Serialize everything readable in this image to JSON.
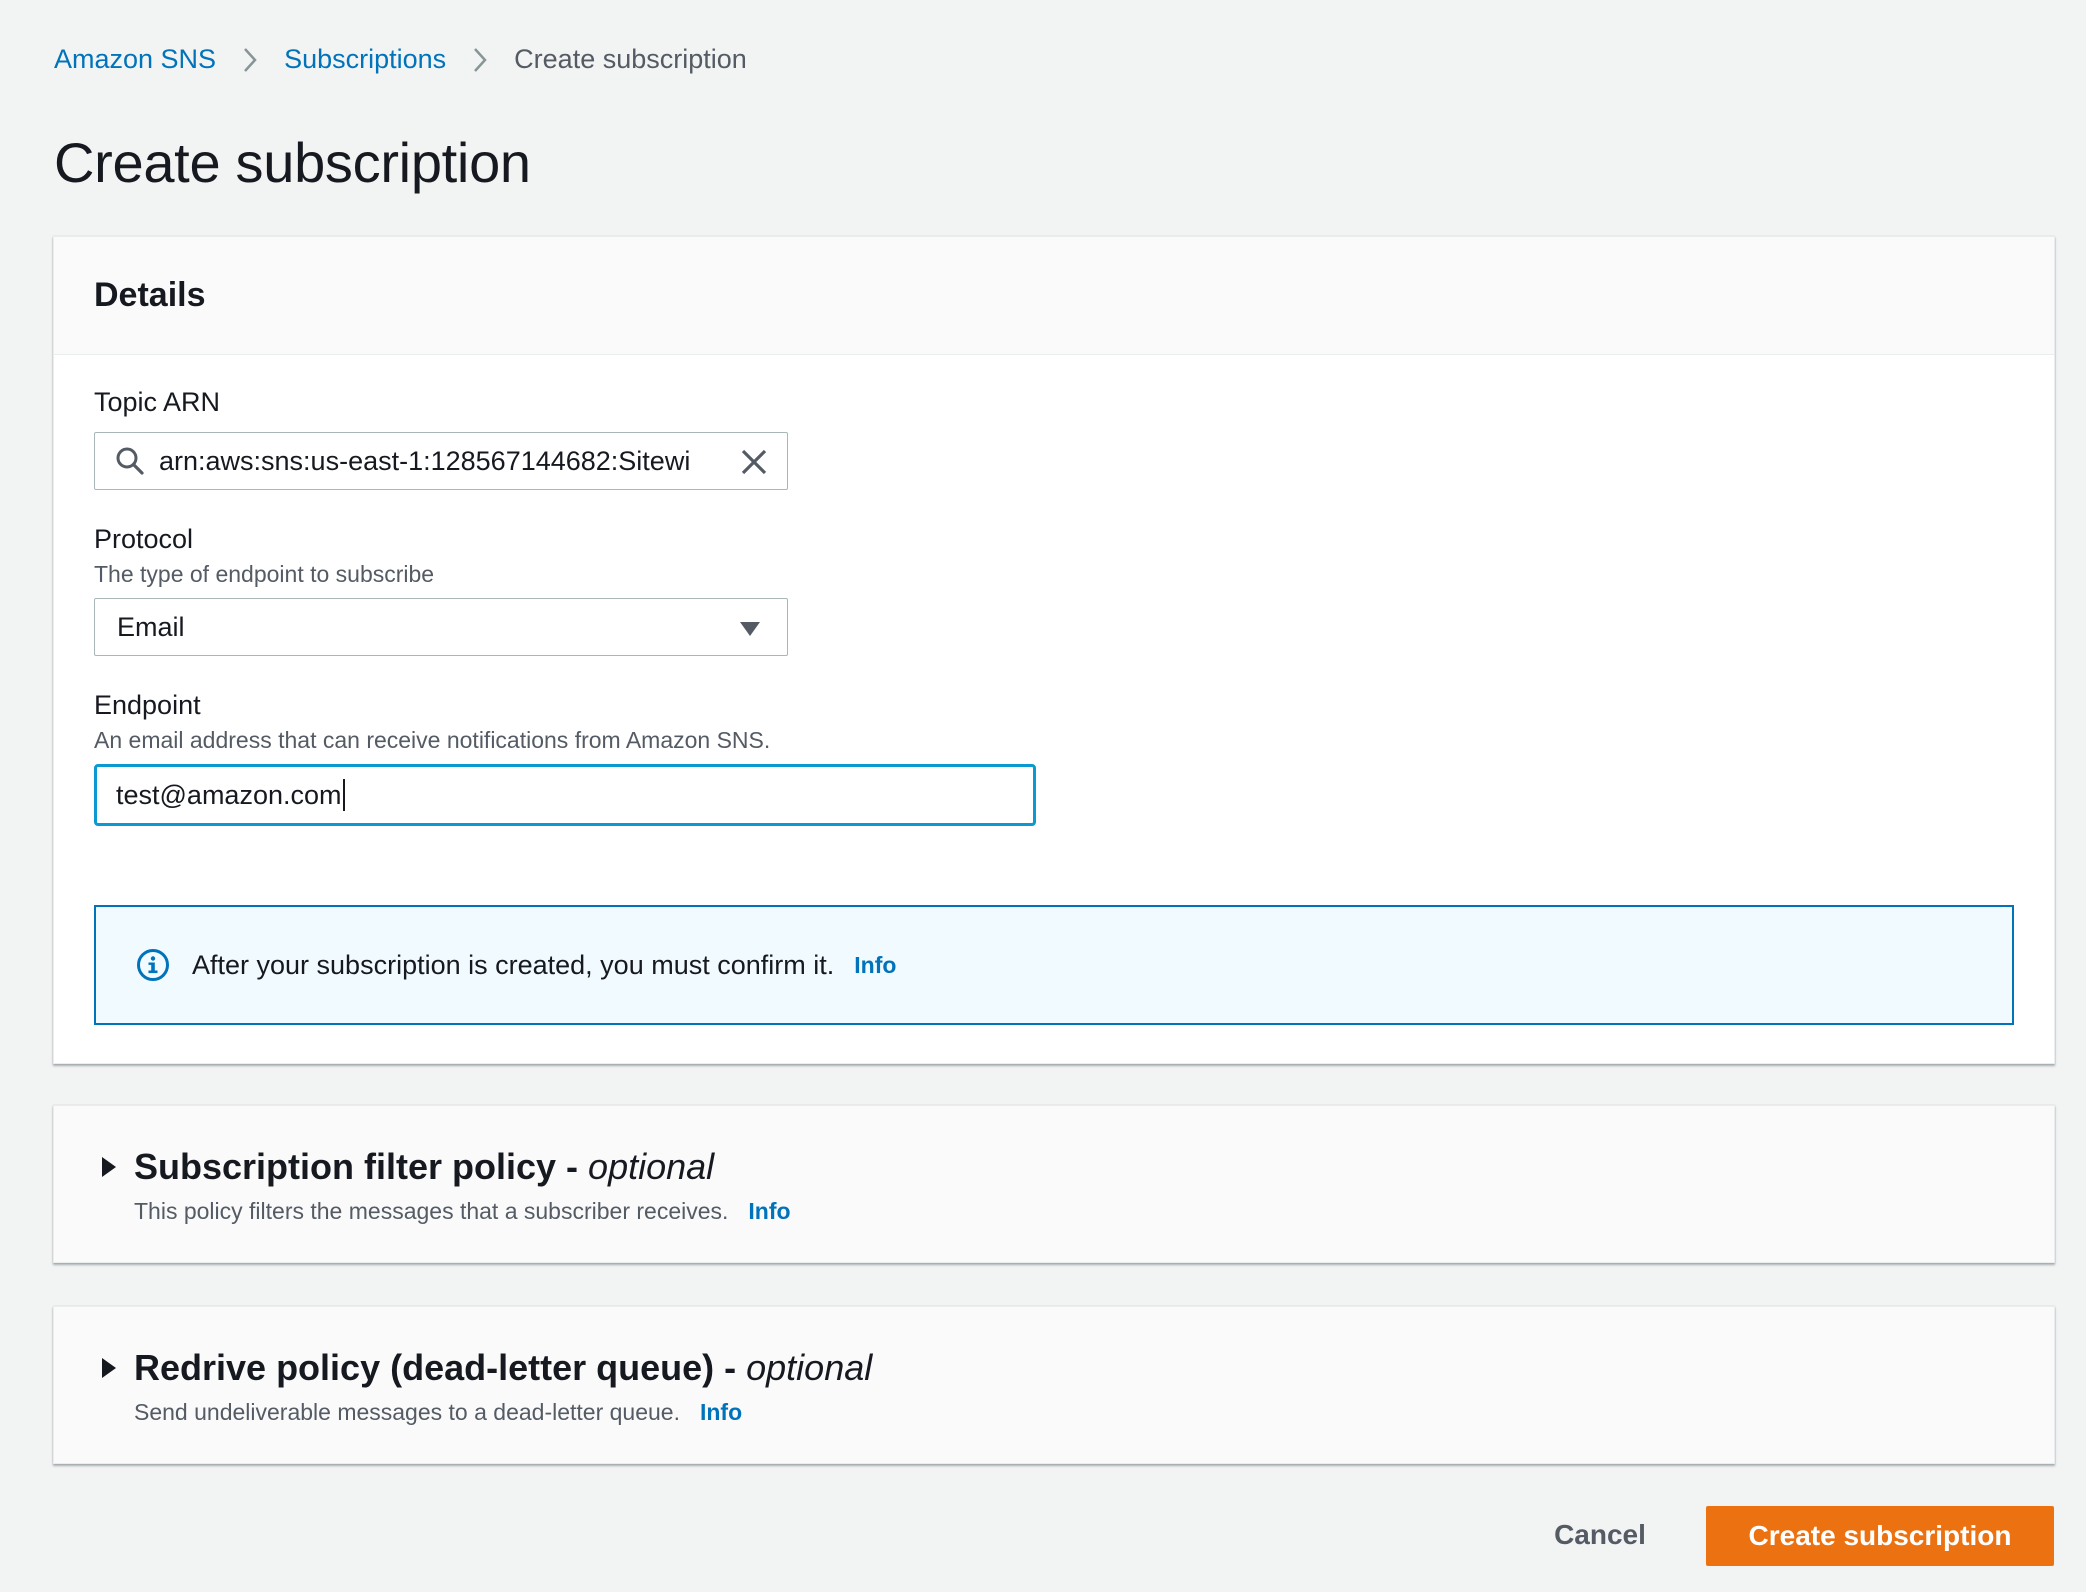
{
  "breadcrumb": {
    "items": [
      {
        "label": "Amazon SNS"
      },
      {
        "label": "Subscriptions"
      },
      {
        "label": "Create subscription"
      }
    ]
  },
  "page": {
    "title": "Create subscription"
  },
  "details": {
    "heading": "Details",
    "topic_arn": {
      "label": "Topic ARN",
      "value": "arn:aws:sns:us-east-1:128567144682:Sitewi"
    },
    "protocol": {
      "label": "Protocol",
      "description": "The type of endpoint to subscribe",
      "selected": "Email"
    },
    "endpoint": {
      "label": "Endpoint",
      "description": "An email address that can receive notifications from Amazon SNS.",
      "value": "test@amazon.com"
    },
    "alert": {
      "message": "After your subscription is created, you must confirm it.",
      "link": "Info"
    }
  },
  "filter_policy": {
    "title": "Subscription filter policy -",
    "optional": "optional",
    "description": "This policy filters the messages that a subscriber receives.",
    "link": "Info"
  },
  "redrive_policy": {
    "title": "Redrive policy (dead-letter queue) -",
    "optional": "optional",
    "description": "Send undeliverable messages to a dead-letter queue.",
    "link": "Info"
  },
  "actions": {
    "cancel": "Cancel",
    "create": "Create subscription"
  },
  "colors": {
    "link": "#0073bb",
    "primary_button": "#ec7211",
    "focus_border": "#0a9ad1",
    "alert_background": "#f1faff"
  }
}
